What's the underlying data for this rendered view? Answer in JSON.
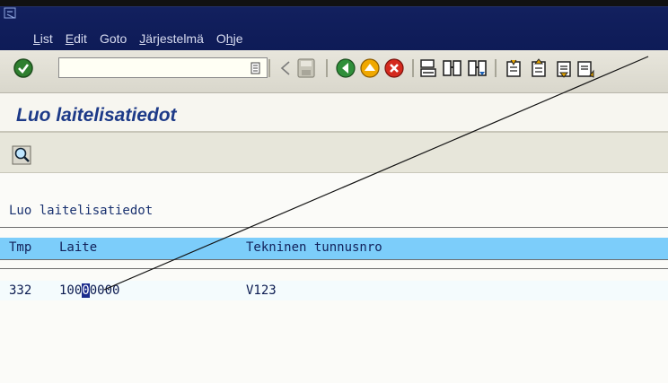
{
  "menubar": {
    "items": [
      {
        "label": "List",
        "underline": "L"
      },
      {
        "label": "Edit",
        "underline": "E"
      },
      {
        "label": "Goto",
        "underline": ""
      },
      {
        "label": "Järjestelmä",
        "underline": "J"
      },
      {
        "label": "Ohje",
        "underline": "h"
      }
    ]
  },
  "toolbar": {
    "command_field_value": "",
    "icons": [
      "enter-check-icon",
      "command-history-icon",
      "prev-icon",
      "save-icon",
      "back-icon",
      "exit-icon",
      "cancel-icon",
      "print-icon",
      "find-icon",
      "find-next-icon",
      "first-page-icon",
      "prev-page-icon"
    ]
  },
  "screen": {
    "title": "Luo laitelisatiedot"
  },
  "list": {
    "title": "Luo laitelisatiedot",
    "columns": [
      "Tmp",
      "Laite",
      "Tekninen tunnusnro"
    ],
    "rows": [
      {
        "tmp": "332",
        "laite_pre": "100",
        "laite_cursor": "0",
        "laite_post": "0000",
        "tunnus": "V123"
      }
    ]
  },
  "colors": {
    "menubar": "#12205e",
    "header_row": "#7ccdfa",
    "title": "#1d3a88"
  }
}
